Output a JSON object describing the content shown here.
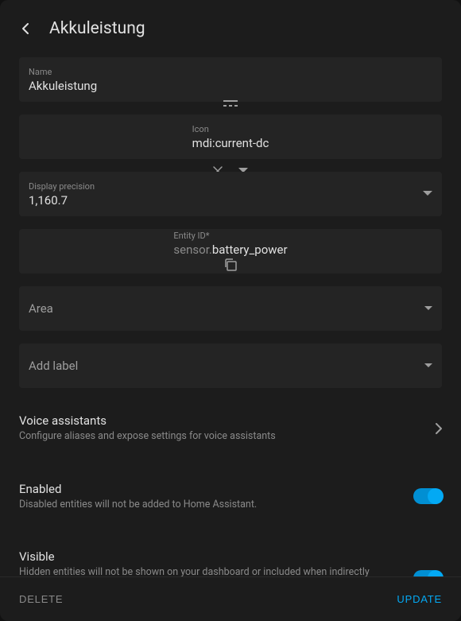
{
  "header": {
    "title": "Akkuleistung"
  },
  "fields": {
    "name": {
      "label": "Name",
      "value": "Akkuleistung"
    },
    "icon": {
      "label": "Icon",
      "value": "mdi:current-dc"
    },
    "display_precision": {
      "label": "Display precision",
      "value": "1,160.7"
    },
    "entity_id": {
      "label": "Entity ID*",
      "prefix": "sensor.",
      "value": "battery_power"
    },
    "area": {
      "placeholder": "Area"
    },
    "label": {
      "placeholder": "Add label"
    }
  },
  "rows": {
    "voice": {
      "title": "Voice assistants",
      "subtitle": "Configure aliases and expose settings for voice assistants"
    },
    "enabled": {
      "title": "Enabled",
      "subtitle": "Disabled entities will not be added to Home Assistant.",
      "value": true
    },
    "visible": {
      "title": "Visible",
      "subtitle": "Hidden entities will not be shown on your dashboard or included when indirectly referenced (ie via an area or device). Their history is still tracked and you can still interact with them with services.",
      "value": true
    }
  },
  "footer": {
    "delete": "Delete",
    "update": "Update"
  }
}
